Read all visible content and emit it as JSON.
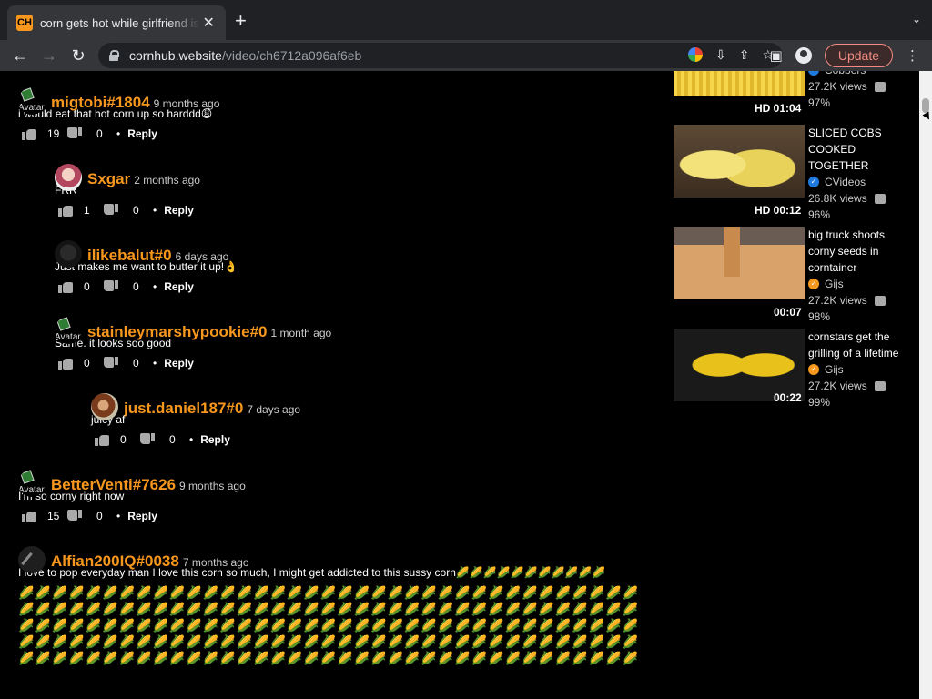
{
  "browser": {
    "tab_title": "corn gets hot while girlfriend is",
    "favicon_text": "CH",
    "url_host": "cornhub.website",
    "url_path": "/video/ch6712a096af6eb",
    "update_label": "Update"
  },
  "comments": [
    {
      "username": "migtobi#1804",
      "time": "9 months ago",
      "text": "i would eat that hot corn up so harddd😩",
      "likes": "19",
      "dislikes": "0",
      "reply": "Reply",
      "avatar_alt": "Avatar"
    },
    {
      "username": "Sxgar",
      "time": "2 months ago",
      "text": "FRR",
      "likes": "1",
      "dislikes": "0",
      "reply": "Reply"
    },
    {
      "username": "ilikebalut#0",
      "time": "6 days ago",
      "text": "Just makes me want to butter it up!👌",
      "likes": "0",
      "dislikes": "0",
      "reply": "Reply"
    },
    {
      "username": "stainleymarshypookie#0",
      "time": "1 month ago",
      "text": "Same. it looks soo good",
      "likes": "0",
      "dislikes": "0",
      "reply": "Reply",
      "avatar_alt": "Avatar"
    },
    {
      "username": "just.daniel187#0",
      "time": "7 days ago",
      "text": "juicy af",
      "likes": "0",
      "dislikes": "0",
      "reply": "Reply"
    },
    {
      "username": "BetterVenti#7626",
      "time": "9 months ago",
      "text": "I'm so corny right now",
      "likes": "15",
      "dislikes": "0",
      "reply": "Reply",
      "avatar_alt": "Avatar"
    },
    {
      "username": "Alfian200IQ#0038",
      "time": "7 months ago",
      "text": "I love to pop everyday man I love this corn so much, I might get addicted to this sussy corn🌽🌽🌽🌽🌽🌽🌽🌽🌽🌽🌽",
      "corn_rows": "🌽🌽🌽🌽🌽🌽🌽🌽🌽🌽🌽🌽🌽🌽🌽🌽🌽🌽🌽🌽🌽🌽🌽🌽🌽🌽🌽🌽🌽🌽🌽🌽🌽🌽🌽🌽🌽🌽🌽🌽🌽🌽🌽🌽🌽🌽🌽🌽🌽🌽🌽🌽🌽🌽🌽🌽🌽🌽🌽🌽🌽🌽🌽🌽🌽🌽🌽🌽🌽🌽🌽🌽🌽🌽🌽🌽🌽🌽🌽🌽🌽🌽🌽🌽🌽🌽🌽🌽🌽🌽🌽🌽🌽🌽🌽🌽🌽🌽🌽🌽🌽🌽🌽🌽🌽🌽🌽🌽🌽🌽🌽🌽🌽🌽🌽🌽🌽🌽🌽🌽🌽🌽🌽🌽🌽🌽🌽🌽🌽🌽🌽🌽🌽🌽🌽🌽🌽🌽🌽🌽🌽🌽🌽🌽🌽🌽🌽🌽🌽🌽🌽🌽🌽🌽🌽🌽🌽🌽🌽🌽🌽🌽🌽🌽🌽🌽🌽🌽🌽🌽🌽🌽🌽🌽🌽🌽🌽🌽🌽🌽🌽🌽🌽🌽🌽",
      "avatar_alt": "Avatar"
    }
  ],
  "videos": [
    {
      "title": "",
      "channel": "Cobbers",
      "views": "27.2K views",
      "rating": "97%",
      "duration": "HD 01:04",
      "badge": "blue"
    },
    {
      "title": "SLICED COBS COOKED TOGETHER",
      "channel": "CVideos",
      "views": "26.8K views",
      "rating": "96%",
      "duration": "HD 00:12",
      "badge": "blue"
    },
    {
      "title": "big truck shoots corny seeds in corntainer",
      "channel": "Gijs",
      "views": "27.2K views",
      "rating": "98%",
      "duration": "00:07",
      "badge": "orange"
    },
    {
      "title": "cornstars get the grilling of a lifetime",
      "channel": "Gijs",
      "views": "27.2K views",
      "rating": "99%",
      "duration": "00:22",
      "badge": "orange"
    }
  ]
}
